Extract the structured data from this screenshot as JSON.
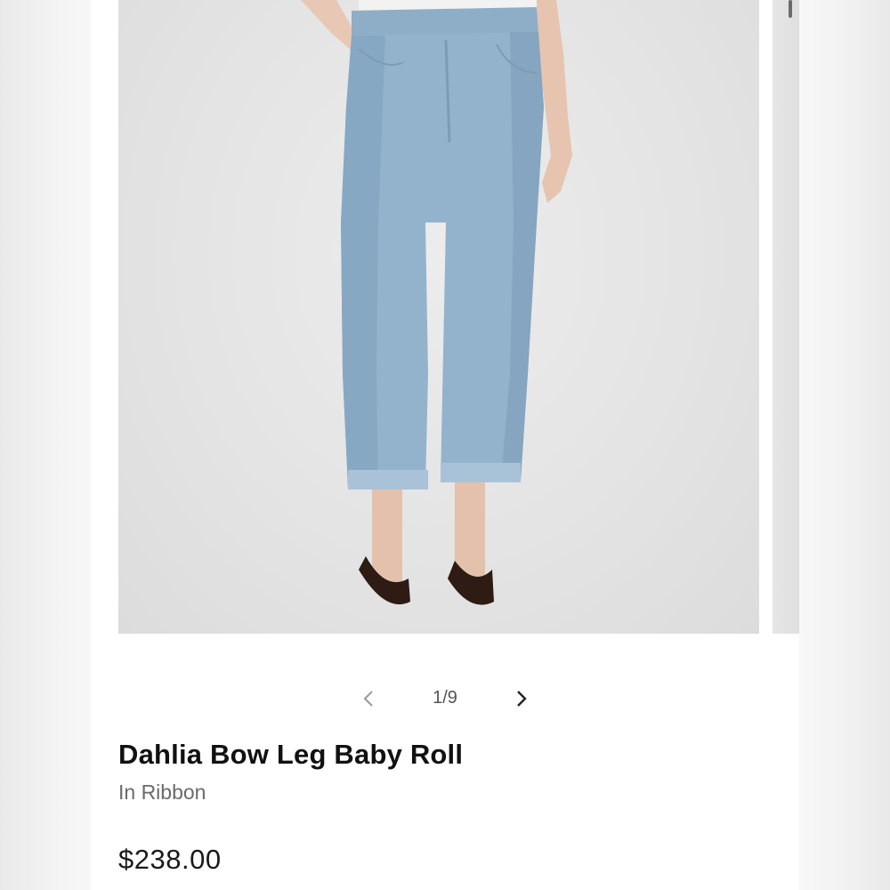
{
  "carousel": {
    "indicator": "1/9",
    "prev_icon": "chevron-left-icon",
    "next_icon": "chevron-right-icon"
  },
  "product": {
    "name": "Dahlia Bow Leg Baby Roll",
    "color": "In Ribbon",
    "price": "$238.00",
    "image_description_icon": "product-photo"
  },
  "colors": {
    "background": "#ffffff",
    "denim": "#8fb0cc",
    "title_text": "#111111",
    "subtitle_text": "#6a6a6a",
    "nav_prev": "#9a9a9a",
    "nav_next": "#222222"
  }
}
